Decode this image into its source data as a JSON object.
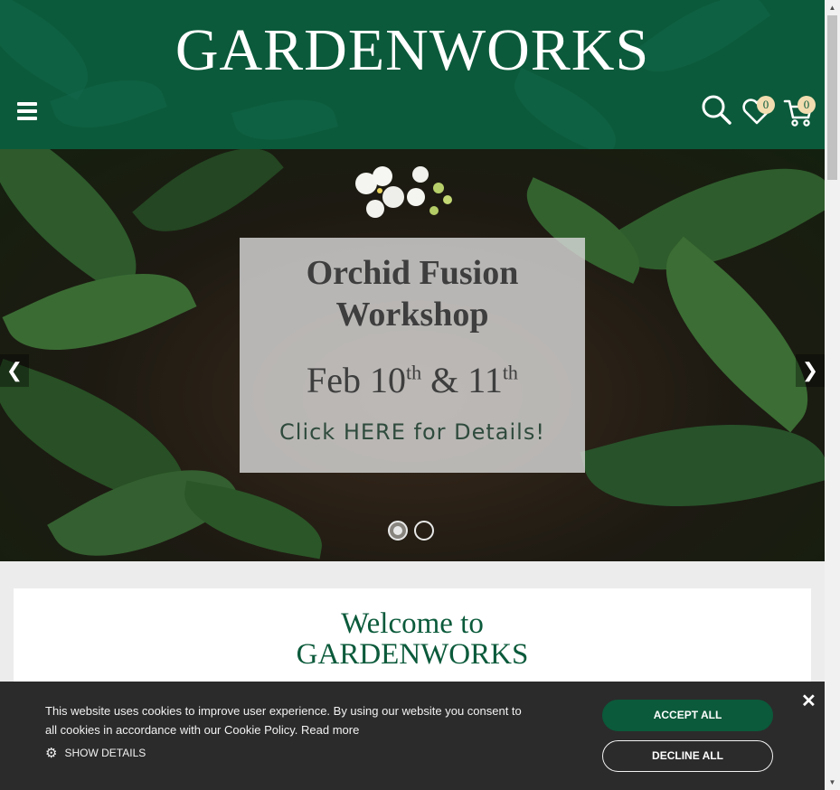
{
  "header": {
    "logo": "GARDENWORKS",
    "wishlist_count": "0",
    "cart_count": "0",
    "icons": [
      "menu-icon",
      "search-icon",
      "heart-icon",
      "cart-icon"
    ]
  },
  "hero": {
    "slide": {
      "title_line1": "Orchid Fusion",
      "title_line2": "Workshop",
      "date_month": "Feb",
      "date_day1": "10",
      "date_sup1": "th",
      "date_amp": "&",
      "date_day2": "11",
      "date_sup2": "th",
      "cta": "Click HERE for Details!"
    },
    "prev_icon": "chevron-left-icon",
    "next_icon": "chevron-right-icon",
    "slide_count": 2,
    "active_slide": 1
  },
  "welcome": {
    "line1": "Welcome to",
    "line2": "GARDENWORKS"
  },
  "cookie": {
    "message": "This website uses cookies to improve user experience. By using our website you consent to all cookies in accordance with our Cookie Policy.",
    "read_more": "Read more",
    "show_details": "SHOW DETAILS",
    "accept_label": "ACCEPT ALL",
    "decline_label": "DECLINE ALL",
    "close_icon": "close-icon"
  },
  "colors": {
    "brand_green": "#0b5a3b",
    "badge_bg": "#f1ddb0",
    "cookie_bg": "#2b2b2b"
  }
}
